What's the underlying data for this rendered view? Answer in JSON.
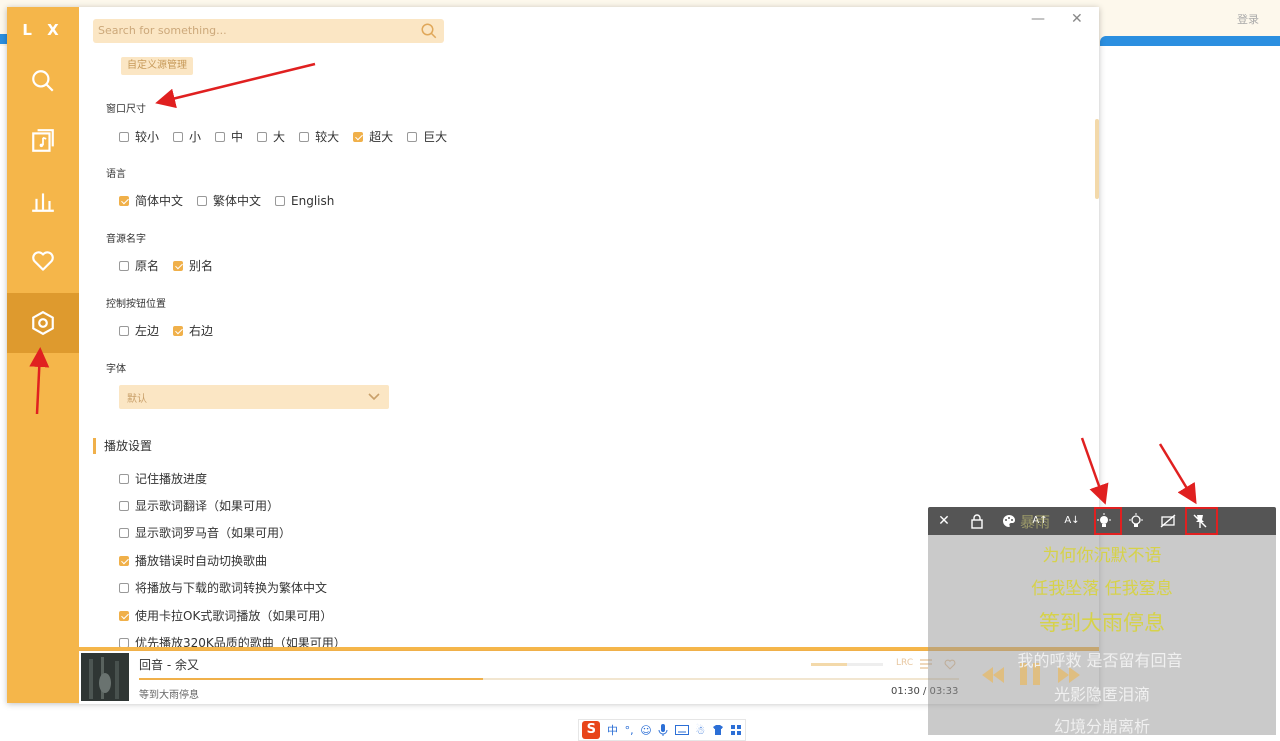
{
  "app": {
    "logo": "L X",
    "login": "登录"
  },
  "search": {
    "placeholder": "Search for something..."
  },
  "window": {
    "minimize": "—",
    "close": "✕"
  },
  "settings": {
    "custom_source_btn": "自定义源管理",
    "window_size": {
      "label": "窗口尺寸",
      "options": [
        {
          "label": "较小",
          "checked": false
        },
        {
          "label": "小",
          "checked": false
        },
        {
          "label": "中",
          "checked": false
        },
        {
          "label": "大",
          "checked": false
        },
        {
          "label": "较大",
          "checked": false
        },
        {
          "label": "超大",
          "checked": true
        },
        {
          "label": "巨大",
          "checked": false
        }
      ]
    },
    "language": {
      "label": "语言",
      "options": [
        {
          "label": "简体中文",
          "checked": true
        },
        {
          "label": "繁体中文",
          "checked": false
        },
        {
          "label": "English",
          "checked": false
        }
      ]
    },
    "source_name": {
      "label": "音源名字",
      "options": [
        {
          "label": "原名",
          "checked": false
        },
        {
          "label": "别名",
          "checked": true
        }
      ]
    },
    "control_pos": {
      "label": "控制按钮位置",
      "options": [
        {
          "label": "左边",
          "checked": false
        },
        {
          "label": "右边",
          "checked": true
        }
      ]
    },
    "font": {
      "label": "字体",
      "value": "默认"
    },
    "playback": {
      "heading": "播放设置",
      "options": [
        {
          "label": "记住播放进度",
          "checked": false
        },
        {
          "label": "显示歌词翻译（如果可用）",
          "checked": false
        },
        {
          "label": "显示歌词罗马音（如果可用）",
          "checked": false
        },
        {
          "label": "播放错误时自动切换歌曲",
          "checked": true
        },
        {
          "label": "将播放与下载的歌词转换为繁体中文",
          "checked": false
        },
        {
          "label": "使用卡拉OK式歌词播放（如果可用）",
          "checked": true
        },
        {
          "label": "优先播放320K品质的歌曲（如果可用）",
          "checked": false
        }
      ]
    }
  },
  "player": {
    "song": "回音 - 余又",
    "lyric": "等到大雨停息",
    "time": "01:30 / 03:33",
    "progress": 0.42,
    "volume": 0.5,
    "lrc_label": "LRC"
  },
  "desktop_lyric": {
    "toolbar": [
      "close-icon",
      "lock-icon",
      "palette-icon",
      "font-increase-icon",
      "font-decrease-icon",
      "bulb-on-icon",
      "bulb-off-icon",
      "hide-icon",
      "unpin-icon"
    ],
    "ghost_title": "暴雨",
    "lines": [
      {
        "text": "为何你沉默不语",
        "color": "#d6d24a",
        "size": 17
      },
      {
        "text": "任我坠落 任我窒息",
        "color": "#d6d24a",
        "size": 17
      },
      {
        "text": "等到大雨停息",
        "color": "#d6d24a",
        "size": 21
      },
      {
        "text": "我的呼救 是否留有回音",
        "color": "#f0f0f0",
        "size": 16
      },
      {
        "text": "光影隐匿泪滴",
        "color": "#f0f0f0",
        "size": 16
      },
      {
        "text": "幻境分崩离析",
        "color": "#f0f0f0",
        "size": 16
      }
    ]
  },
  "taskbar": {
    "ime_logo": "S",
    "ime_mode": "中",
    "ime_symbol": "°,"
  },
  "colors": {
    "accent": "#f5b64a",
    "accent_dark": "#de9a2e",
    "annotation": "#e02020"
  }
}
